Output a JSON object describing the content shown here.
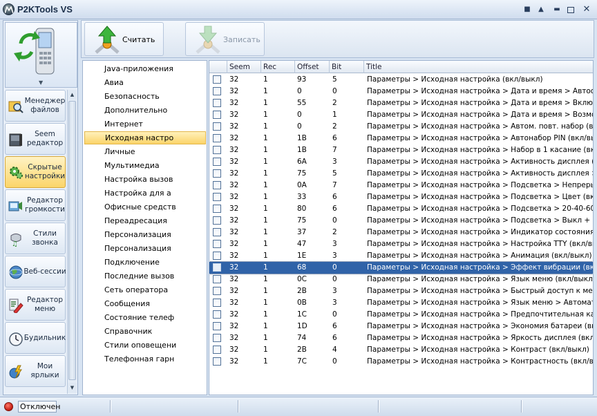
{
  "app": {
    "title": "P2KTools VS"
  },
  "window_controls": [
    "minimize-to-tray",
    "collapse",
    "maximize",
    "close"
  ],
  "nav": {
    "items": [
      {
        "label": "Менеджер файлов",
        "icon": "file-manager-icon",
        "active": false
      },
      {
        "label": "Seem редактор",
        "icon": "seem-editor-icon",
        "active": false
      },
      {
        "label": "Скрытые настройки",
        "icon": "hidden-settings-gear-icon",
        "active": true
      },
      {
        "label": "Редактор громкости",
        "icon": "volume-editor-icon",
        "active": false
      },
      {
        "label": "Стили звонка",
        "icon": "ringtone-styles-icon",
        "active": false
      },
      {
        "label": "Веб-сессии",
        "icon": "web-sessions-globe-icon",
        "active": false
      },
      {
        "label": "Редактор меню",
        "icon": "menu-editor-icon",
        "active": false
      },
      {
        "label": "Будильник",
        "icon": "alarm-clock-icon",
        "active": false
      },
      {
        "label": "Мои ярлыки",
        "icon": "my-shortcuts-icon",
        "active": false
      }
    ]
  },
  "toolbar": {
    "read_label": "Считать",
    "write_label": "Записать"
  },
  "categories": {
    "selected_index": 5,
    "items": [
      "Java-приложения",
      "Авиа",
      "Безопасность",
      "Дополнительно",
      "Интернет",
      "Исходная настро",
      "Личные",
      "Мультимедиа",
      "Настройка вызов",
      "Настройка для а",
      "Офисные средств",
      "Переадресация",
      "Персонализация",
      "Персонализация",
      "Подключение",
      "Последние вызов",
      "Сеть оператора",
      "Сообщения",
      "Состояние телеф",
      "Справочник",
      "Стили оповещени",
      "Телефонная гарн"
    ]
  },
  "grid": {
    "columns": [
      "Seem",
      "Rec",
      "Offset",
      "Bit",
      "Title"
    ],
    "selected_index": 16,
    "rows": [
      [
        "32",
        "1",
        "93",
        "5",
        "Параметры > Исходная настройка (вкл/выкл)"
      ],
      [
        "32",
        "1",
        "0",
        "0",
        "Параметры > Исходная настройка > Дата и время > Автооб..."
      ],
      [
        "32",
        "1",
        "55",
        "2",
        "Параметры > Исходная настройка > Дата и время > Включи..."
      ],
      [
        "32",
        "1",
        "0",
        "1",
        "Параметры > Исходная настройка > Дата и время > Возмо..."
      ],
      [
        "32",
        "1",
        "0",
        "2",
        "Параметры > Исходная настройка > Автом. повт. набор (вк..."
      ],
      [
        "32",
        "1",
        "1B",
        "6",
        "Параметры > Исходная настройка > Автонабор PIN (вкл/вы..."
      ],
      [
        "32",
        "1",
        "1B",
        "7",
        "Параметры > Исходная настройка > Набор в 1 касание (вкл/..."
      ],
      [
        "32",
        "1",
        "6A",
        "3",
        "Параметры > Исходная настройка > Активность дисплея (в..."
      ],
      [
        "32",
        "1",
        "75",
        "5",
        "Параметры > Исходная настройка > Активность дисплея > ..."
      ],
      [
        "32",
        "1",
        "0A",
        "7",
        "Параметры > Исходная настройка > Подсветка > Непрерыв..."
      ],
      [
        "32",
        "1",
        "33",
        "6",
        "Параметры > Исходная настройка > Подсветка > Цвет (вкл/..."
      ],
      [
        "32",
        "1",
        "80",
        "6",
        "Параметры > Исходная настройка > Подсветка > 20-40-60 с..."
      ],
      [
        "32",
        "1",
        "75",
        "0",
        "Параметры > Исходная настройка > Подсветка > Выкл + 30 ..."
      ],
      [
        "32",
        "1",
        "37",
        "2",
        "Параметры > Исходная настройка > Индикатор состояния (..."
      ],
      [
        "32",
        "1",
        "47",
        "3",
        "Параметры > Исходная настройка > Настройка TTY (вкл/вы..."
      ],
      [
        "32",
        "1",
        "1E",
        "3",
        "Параметры > Исходная настройка > Анимация (вкл/выкл)"
      ],
      [
        "32",
        "1",
        "68",
        "0",
        "Параметры > Исходная настройка > Эффект вибрации (вкл/..."
      ],
      [
        "32",
        "1",
        "0C",
        "0",
        "Параметры > Исходная настройка > Язык меню (вкл/выкл)"
      ],
      [
        "32",
        "1",
        "2B",
        "3",
        "Параметры > Исходная настройка > Быстрый доступ к мен..."
      ],
      [
        "32",
        "1",
        "0B",
        "3",
        "Параметры > Исходная настройка > Язык меню > Автомати..."
      ],
      [
        "32",
        "1",
        "1C",
        "0",
        "Параметры > Исходная настройка > Предпочтительная кар..."
      ],
      [
        "32",
        "1",
        "1D",
        "6",
        "Параметры > Исходная настройка > Экономия батареи (вкл..."
      ],
      [
        "32",
        "1",
        "74",
        "6",
        "Параметры > Исходная настройка > Яркость дисплея (вкл/..."
      ],
      [
        "32",
        "1",
        "2B",
        "4",
        "Параметры > Исходная настройка > Контраст (вкл/выкл)"
      ],
      [
        "32",
        "1",
        "7C",
        "0",
        "Параметры > Исходная настройка > Контрастность (вкл/вы..."
      ]
    ]
  },
  "status": {
    "connection": "Отключен",
    "indicator_color": "#d0241a"
  },
  "colors": {
    "selection": "#3063a8",
    "active_nav": "#fbd56a"
  }
}
